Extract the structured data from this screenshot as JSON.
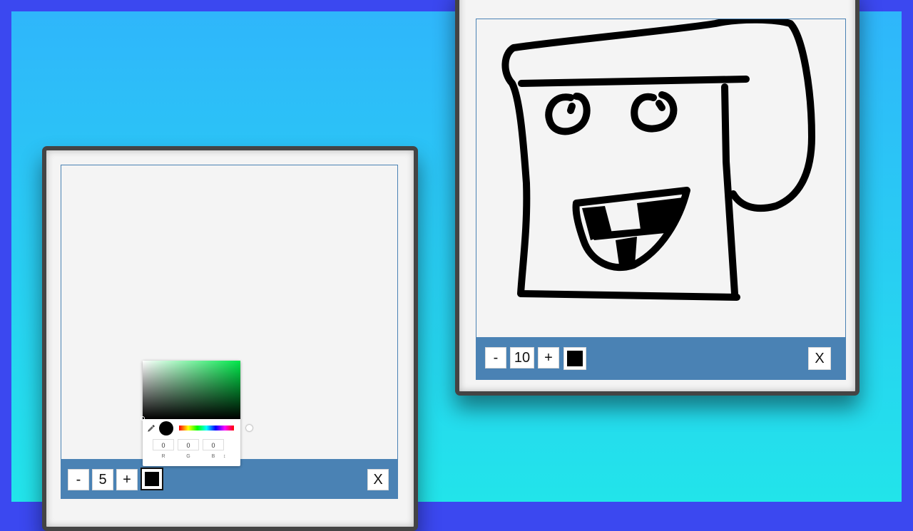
{
  "left_window": {
    "toolbar": {
      "minus_label": "-",
      "brush_size": "5",
      "plus_label": "+",
      "current_color": "#000000",
      "close_label": "X"
    },
    "color_picker": {
      "preview_color": "#000000",
      "fields": [
        {
          "label": "R",
          "value": "0"
        },
        {
          "label": "G",
          "value": "0"
        },
        {
          "label": "B",
          "value": "0"
        }
      ],
      "mode_toggle": "↕"
    }
  },
  "right_window": {
    "toolbar": {
      "minus_label": "-",
      "brush_size": "10",
      "plus_label": "+",
      "current_color": "#000000",
      "close_label": "X"
    }
  },
  "colors": {
    "page_border": "#3b48f0",
    "toolbar": "#4a82b4",
    "frame": "#444444",
    "canvas": "#f4f4f4"
  }
}
